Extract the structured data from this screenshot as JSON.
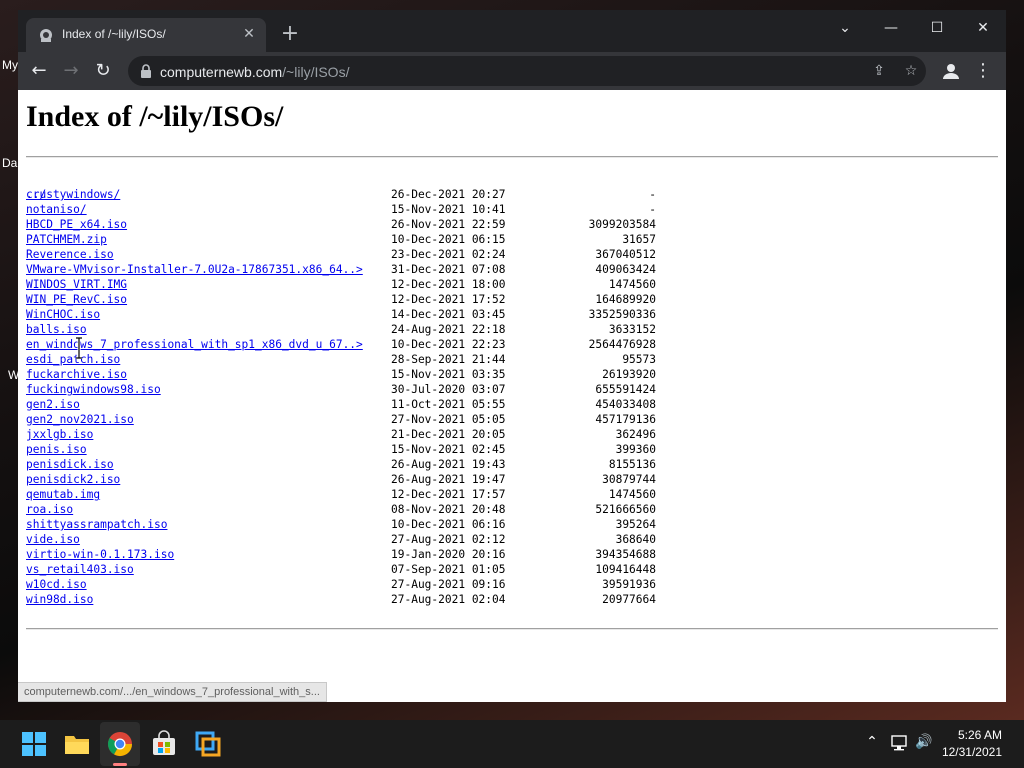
{
  "desktop": {
    "labels": [
      "My",
      "Da",
      "W"
    ]
  },
  "tab": {
    "title": "Index of /~lily/ISOs/"
  },
  "toolbar": {
    "url_host": "computernewb.com",
    "url_path": "/~lily/ISOs/"
  },
  "page": {
    "title": "Index of /~lily/ISOs/",
    "parent_link": "../",
    "entries": [
      {
        "name": "crustywindows/",
        "date": "26-Dec-2021 20:27",
        "size": "-"
      },
      {
        "name": "notaniso/",
        "date": "15-Nov-2021 10:41",
        "size": "-"
      },
      {
        "name": "HBCD_PE_x64.iso",
        "date": "26-Nov-2021 22:59",
        "size": "3099203584"
      },
      {
        "name": "PATCHMEM.zip",
        "date": "10-Dec-2021 06:15",
        "size": "31657"
      },
      {
        "name": "Reverence.iso",
        "date": "23-Dec-2021 02:24",
        "size": "367040512"
      },
      {
        "name": "VMware-VMvisor-Installer-7.0U2a-17867351.x86_64..>",
        "date": "31-Dec-2021 07:08",
        "size": "409063424"
      },
      {
        "name": "WINDOS_VIRT.IMG",
        "date": "12-Dec-2021 18:00",
        "size": "1474560"
      },
      {
        "name": "WIN_PE_RevC.iso",
        "date": "12-Dec-2021 17:52",
        "size": "164689920"
      },
      {
        "name": "WinCHOC.iso",
        "date": "14-Dec-2021 03:45",
        "size": "3352590336"
      },
      {
        "name": "balls.iso",
        "date": "24-Aug-2021 22:18",
        "size": "3633152"
      },
      {
        "name": "en_windows_7_professional_with_sp1_x86_dvd_u_67..>",
        "date": "10-Dec-2021 22:23",
        "size": "2564476928"
      },
      {
        "name": "esdi_patch.iso",
        "date": "28-Sep-2021 21:44",
        "size": "95573"
      },
      {
        "name": "fuckarchive.iso",
        "date": "15-Nov-2021 03:35",
        "size": "26193920"
      },
      {
        "name": "fuckingwindows98.iso",
        "date": "30-Jul-2020 03:07",
        "size": "655591424"
      },
      {
        "name": "gen2.iso",
        "date": "11-Oct-2021 05:55",
        "size": "454033408"
      },
      {
        "name": "gen2_nov2021.iso",
        "date": "27-Nov-2021 05:05",
        "size": "457179136"
      },
      {
        "name": "jxxlgb.iso",
        "date": "21-Dec-2021 20:05",
        "size": "362496"
      },
      {
        "name": "penis.iso",
        "date": "15-Nov-2021 02:45",
        "size": "399360"
      },
      {
        "name": "penisdick.iso",
        "date": "26-Aug-2021 19:43",
        "size": "8155136"
      },
      {
        "name": "penisdick2.iso",
        "date": "26-Aug-2021 19:47",
        "size": "30879744"
      },
      {
        "name": "qemutab.img",
        "date": "12-Dec-2021 17:57",
        "size": "1474560"
      },
      {
        "name": "roa.iso",
        "date": "08-Nov-2021 20:48",
        "size": "521666560"
      },
      {
        "name": "shittyassrampatch.iso",
        "date": "10-Dec-2021 06:16",
        "size": "395264"
      },
      {
        "name": "vide.iso",
        "date": "27-Aug-2021 02:12",
        "size": "368640"
      },
      {
        "name": "virtio-win-0.1.173.iso",
        "date": "19-Jan-2020 20:16",
        "size": "394354688"
      },
      {
        "name": "vs_retail403.iso",
        "date": "07-Sep-2021 01:05",
        "size": "109416448"
      },
      {
        "name": "w10cd.iso",
        "date": "27-Aug-2021 09:16",
        "size": "39591936"
      },
      {
        "name": "win98d.iso",
        "date": "27-Aug-2021 02:04",
        "size": "20977664"
      }
    ]
  },
  "status_bar": {
    "hover_url": "computernewb.com/.../en_windows_7_professional_with_s..."
  },
  "taskbar": {
    "apps": [
      "start-icon",
      "file-explorer-icon",
      "chrome-icon",
      "microsoft-store-icon",
      "vmware-icon"
    ],
    "clock_time": "5:26 AM",
    "clock_date": "12/31/2021"
  },
  "colors": {
    "link": "#0000ee",
    "tab_bar": "#202124",
    "toolbar": "#35363a",
    "taskbar": "#1c1c1c"
  }
}
